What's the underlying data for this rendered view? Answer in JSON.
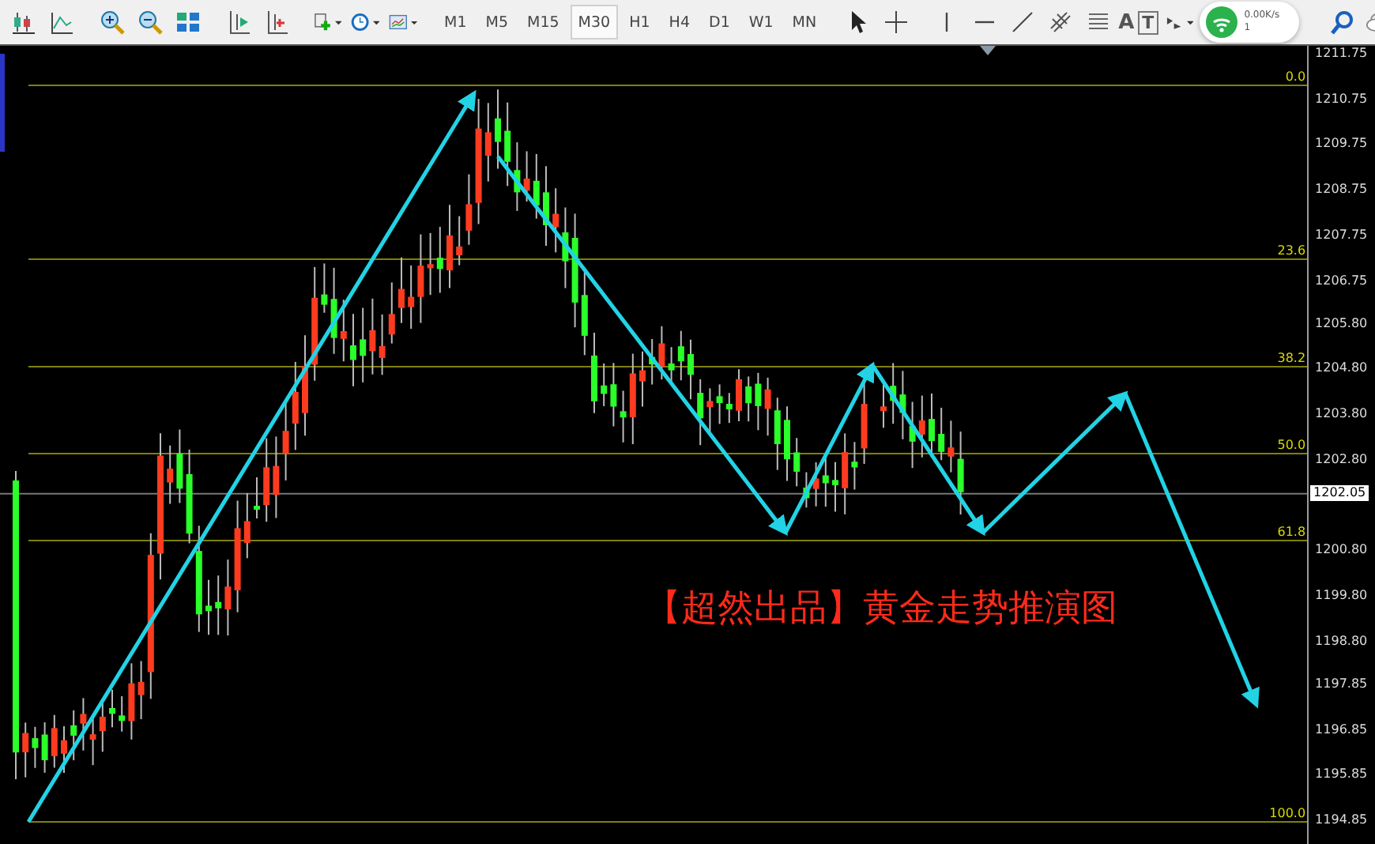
{
  "toolbar": {
    "timeframes": [
      {
        "label": "M1",
        "selected": false
      },
      {
        "label": "M5",
        "selected": false
      },
      {
        "label": "M15",
        "selected": false
      },
      {
        "label": "M30",
        "selected": true
      },
      {
        "label": "H1",
        "selected": false
      },
      {
        "label": "H4",
        "selected": false
      },
      {
        "label": "D1",
        "selected": false
      },
      {
        "label": "W1",
        "selected": false
      },
      {
        "label": "MN",
        "selected": false
      }
    ],
    "text_tools": [
      "A",
      "T"
    ],
    "network": {
      "speed": "0.00K/s",
      "connections": "1"
    }
  },
  "chart": {
    "price_axis": {
      "labels": [
        "1211.75",
        "1210.75",
        "1209.75",
        "1208.75",
        "1207.75",
        "1206.75",
        "1205.80",
        "1204.80",
        "1203.80",
        "1202.80",
        "1200.80",
        "1199.80",
        "1198.80",
        "1197.85",
        "1196.85",
        "1195.85",
        "1194.85"
      ],
      "current_price": "1202.05"
    },
    "fib_levels": [
      "0.0",
      "23.6",
      "38.2",
      "50.0",
      "61.8",
      "100.0"
    ],
    "caption": "【超然出品】黄金走势推演图"
  }
}
